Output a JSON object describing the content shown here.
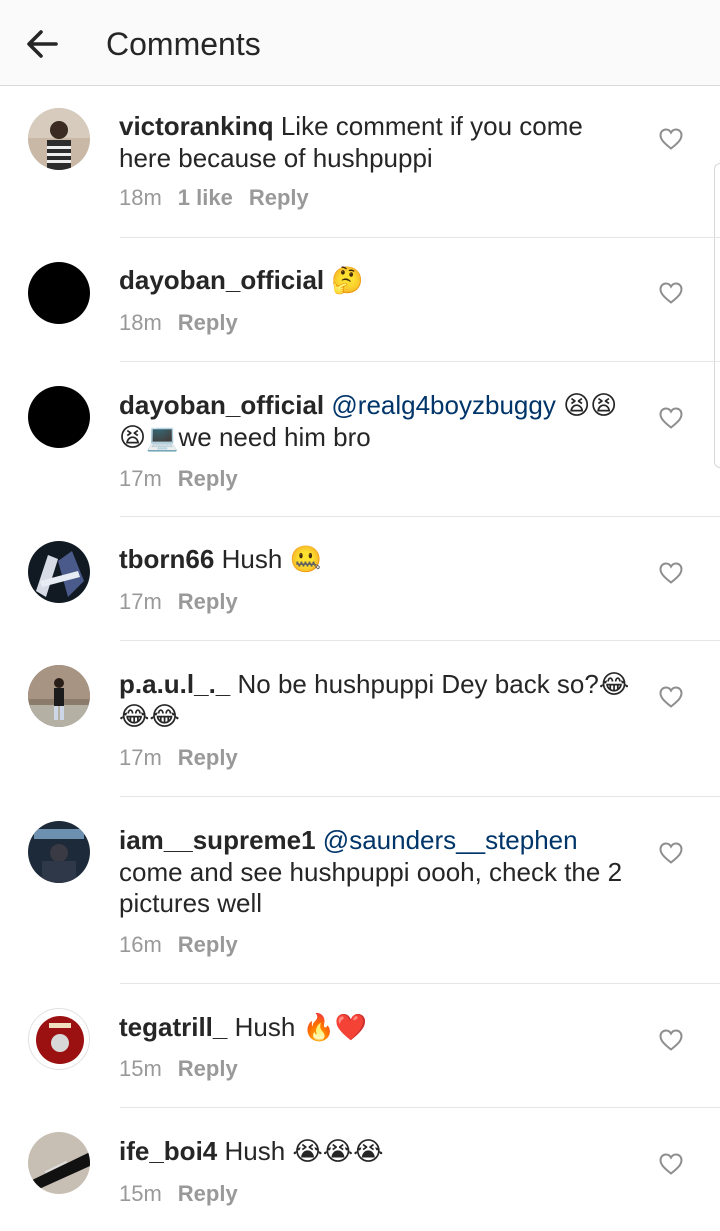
{
  "header": {
    "title": "Comments",
    "back_icon": "arrow-left-icon"
  },
  "comments": [
    {
      "username": "victorankinq",
      "text": "Like comment if you come here because of hushpuppi",
      "time": "18m",
      "likes": "1 like",
      "reply": "Reply"
    },
    {
      "username": "dayoban_official",
      "text": "🤔",
      "time": "18m",
      "reply": "Reply"
    },
    {
      "username": "dayoban_official",
      "mention": "@realg4boyzbuggy",
      "text": "😫😫😫💻we need him bro",
      "time": "17m",
      "reply": "Reply"
    },
    {
      "username": "tborn66",
      "text": "Hush 🤐",
      "time": "17m",
      "reply": "Reply"
    },
    {
      "username": "p.a.u.l_._",
      "text": "No be hushpuppi Dey back so?😂😂😂",
      "time": "17m",
      "reply": "Reply"
    },
    {
      "username": "iam__supreme1",
      "mention": "@saunders__stephen",
      "text": "come and see hushpuppi oooh, check the 2 pictures well",
      "time": "16m",
      "reply": "Reply"
    },
    {
      "username": "tegatrill_",
      "text": "Hush 🔥❤️",
      "time": "15m",
      "reply": "Reply"
    },
    {
      "username": "ife_boi4",
      "text": "Hush 😭😭😭",
      "time": "15m",
      "reply": "Reply"
    }
  ],
  "colors": {
    "username": "#262626",
    "mention": "#003569",
    "meta": "#999999",
    "divider": "#e6e6e6",
    "header_bg": "#fafafa"
  },
  "icons": {
    "like": "heart-outline-icon"
  }
}
